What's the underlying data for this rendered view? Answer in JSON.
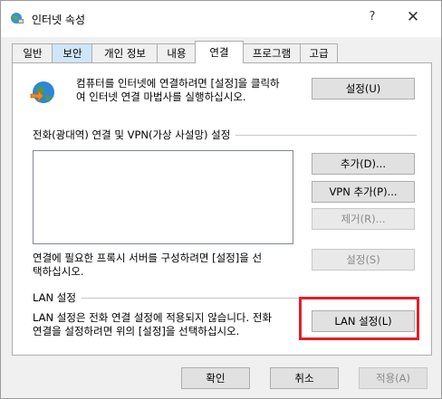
{
  "window": {
    "title": "인터넷 속성",
    "help_label": "?",
    "close_label": "✕"
  },
  "tabs": [
    {
      "label": "일반"
    },
    {
      "label": "보안"
    },
    {
      "label": "개인 정보"
    },
    {
      "label": "내용"
    },
    {
      "label": "연결",
      "active": true
    },
    {
      "label": "프로그램"
    },
    {
      "label": "고급"
    }
  ],
  "setup": {
    "line1": "컴퓨터를 인터넷에 연결하려면 [설정]을 클릭하",
    "line2": "여 인터넷 연결 마법사를 실행하십시오.",
    "button": "설정(U)"
  },
  "dialup": {
    "group_title": "전화(광대역) 연결 및 VPN(가상 사설망) 설정",
    "add_button": "추가(D)...",
    "add_vpn_button": "VPN 추가(P)...",
    "remove_button": "제거(R)...",
    "proxy_line1": "연결에 필요한 프록시 서버를 구성하려면 [설정]을 선",
    "proxy_line2": "택하십시오.",
    "settings_button": "설정(S)"
  },
  "lan": {
    "group_title": "LAN 설정",
    "line1": "LAN 설정은 전화 연결 설정에 적용되지 않습니다. 전화",
    "line2": "연결을 설정하려면 위의 [설정]을 선택하십시오.",
    "button": "LAN 설정(L)"
  },
  "footer": {
    "ok": "확인",
    "cancel": "취소",
    "apply": "적용(A)"
  },
  "colors": {
    "highlight_box": "#e0202a",
    "hover_tab": "#cfe6f8"
  }
}
